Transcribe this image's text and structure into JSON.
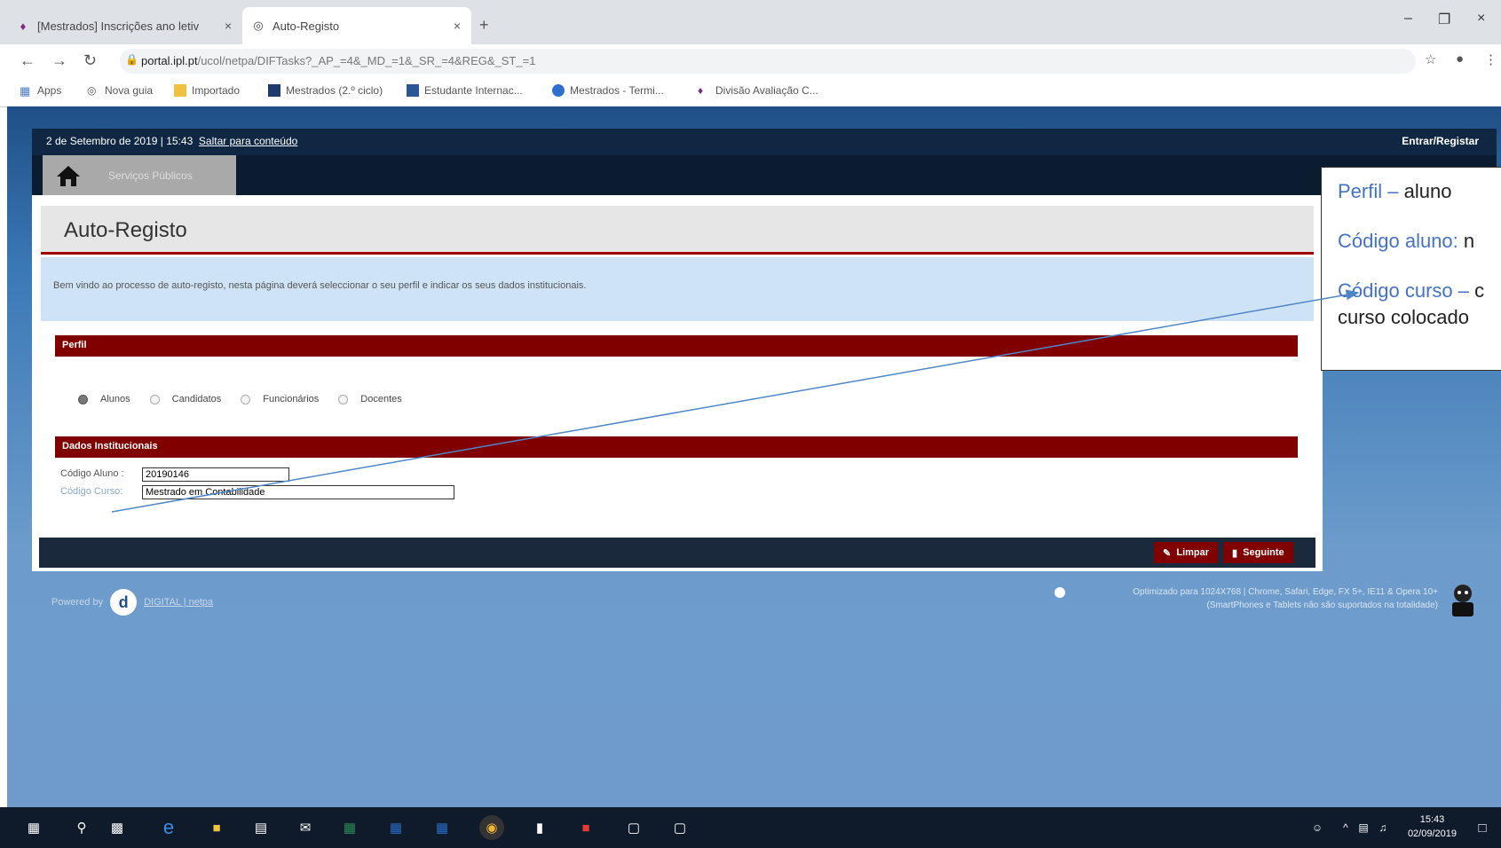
{
  "browser": {
    "tabs": [
      {
        "label": "[Mestrados] Inscrições ano letiv",
        "icon": "shield-icon"
      },
      {
        "label": "Auto-Registo",
        "icon": "globe-icon"
      }
    ],
    "url": {
      "host": "portal.ipl.pt",
      "path": "/ucol/netpa/DIFTasks?_AP_=4&_MD_=1&_SR_=4&REG&_ST_=1"
    },
    "bookmarks": [
      {
        "label": "Apps",
        "icon": "apps-grid-icon"
      },
      {
        "label": "Nova guia",
        "icon": "globe-icon"
      },
      {
        "label": "Importado",
        "icon": "folder-icon"
      },
      {
        "label": "Mestrados (2.º ciclo)",
        "icon": "bookmark-icon"
      },
      {
        "label": "Estudante Internac...",
        "icon": "bookmark-icon"
      },
      {
        "label": "Mestrados - Termi...",
        "icon": "shield-icon"
      },
      {
        "label": "Divisão Avaliação C...",
        "icon": "shield-icon"
      }
    ]
  },
  "page": {
    "datetime": "2 de Setembro de 2019 | 15:43",
    "skip_link": "Saltar para conteúdo",
    "login_link": "Entrar/Registar",
    "home_tab": "Serviços Públicos",
    "title": "Auto-Registo",
    "info": "Bem vindo ao processo de auto-registo, nesta página deverá seleccionar o seu perfil e indicar os seus dados institucionais.",
    "perfil_header": "Perfil",
    "perfil_options": [
      {
        "label": "Alunos",
        "selected": true
      },
      {
        "label": "Candidatos",
        "selected": false
      },
      {
        "label": "Funcionários",
        "selected": false
      },
      {
        "label": "Docentes",
        "selected": false
      }
    ],
    "dados_header": "Dados Institucionais",
    "codigo_aluno_label": "Código Aluno :",
    "codigo_aluno_value": "20190146",
    "codigo_curso_label": "Código Curso:",
    "codigo_curso_value": "Mestrado em Contabilidade",
    "limpar": "Limpar",
    "seguinte": "Seguinte",
    "powered_by": "Powered by",
    "powered_brand": "DIGITAL | netpa",
    "optimized_text_1": "Optimizado para 1024X768 | Chrome, Safari, Edge, FX 5+, IE11 & Opera 10+",
    "optimized_text_2": "(SmartPhones e Tablets não são suportados na totalidade)"
  },
  "annotation": {
    "line1_key": "Perfil –",
    "line1_val": " aluno",
    "line2_key": "Código aluno:",
    "line2_val": " n",
    "line3_key": "Código curso –",
    "line3_val": " c",
    "line4": "curso colocado"
  },
  "taskbar": {
    "time": "15:43",
    "date": "02/09/2019"
  }
}
